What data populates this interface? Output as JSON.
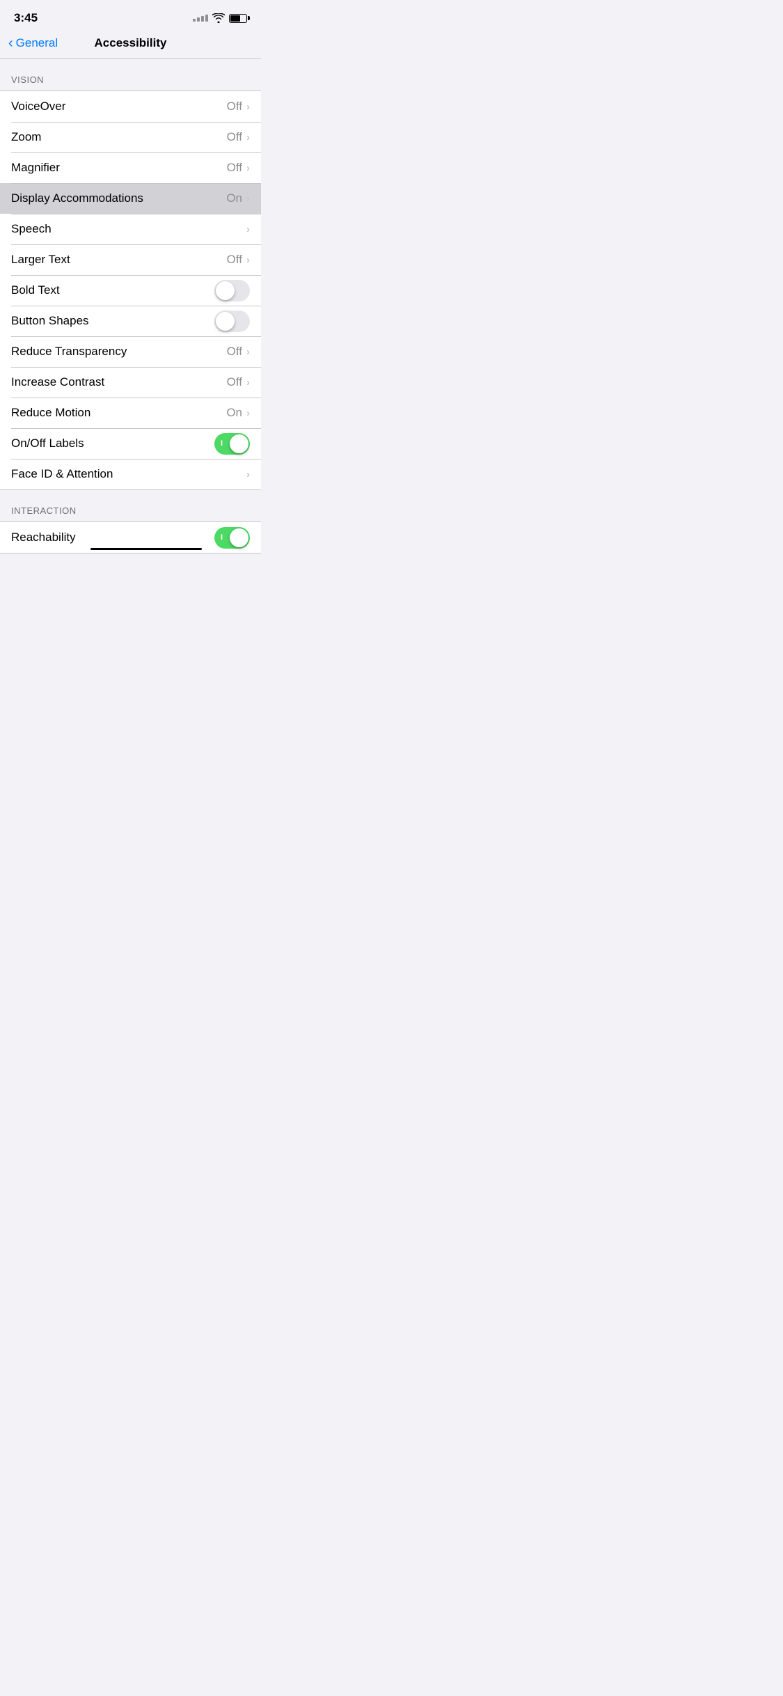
{
  "statusBar": {
    "time": "3:45",
    "wifi": true,
    "battery": 65
  },
  "nav": {
    "backLabel": "General",
    "title": "Accessibility"
  },
  "sections": [
    {
      "header": "VISION",
      "items": [
        {
          "label": "VoiceOver",
          "rightText": "Off",
          "type": "chevron",
          "highlighted": false
        },
        {
          "label": "Zoom",
          "rightText": "Off",
          "type": "chevron",
          "highlighted": false
        },
        {
          "label": "Magnifier",
          "rightText": "Off",
          "type": "chevron",
          "highlighted": false
        },
        {
          "label": "Display Accommodations",
          "rightText": "On",
          "type": "chevron",
          "highlighted": true
        },
        {
          "label": "Speech",
          "rightText": "",
          "type": "chevron",
          "highlighted": false
        },
        {
          "label": "Larger Text",
          "rightText": "Off",
          "type": "chevron",
          "highlighted": false
        },
        {
          "label": "Bold Text",
          "rightText": "",
          "type": "toggle",
          "toggleState": "off",
          "highlighted": false
        },
        {
          "label": "Button Shapes",
          "rightText": "",
          "type": "toggle",
          "toggleState": "off",
          "highlighted": false
        },
        {
          "label": "Reduce Transparency",
          "rightText": "Off",
          "type": "chevron",
          "highlighted": false
        },
        {
          "label": "Increase Contrast",
          "rightText": "Off",
          "type": "chevron",
          "highlighted": false
        },
        {
          "label": "Reduce Motion",
          "rightText": "On",
          "type": "chevron",
          "highlighted": false
        },
        {
          "label": "On/Off Labels",
          "rightText": "",
          "type": "toggle",
          "toggleState": "on",
          "highlighted": false
        },
        {
          "label": "Face ID & Attention",
          "rightText": "",
          "type": "chevron",
          "highlighted": false
        }
      ]
    },
    {
      "header": "INTERACTION",
      "items": [
        {
          "label": "Reachability",
          "rightText": "",
          "type": "toggle",
          "toggleState": "on",
          "highlighted": false,
          "hasLine": true
        }
      ]
    }
  ]
}
